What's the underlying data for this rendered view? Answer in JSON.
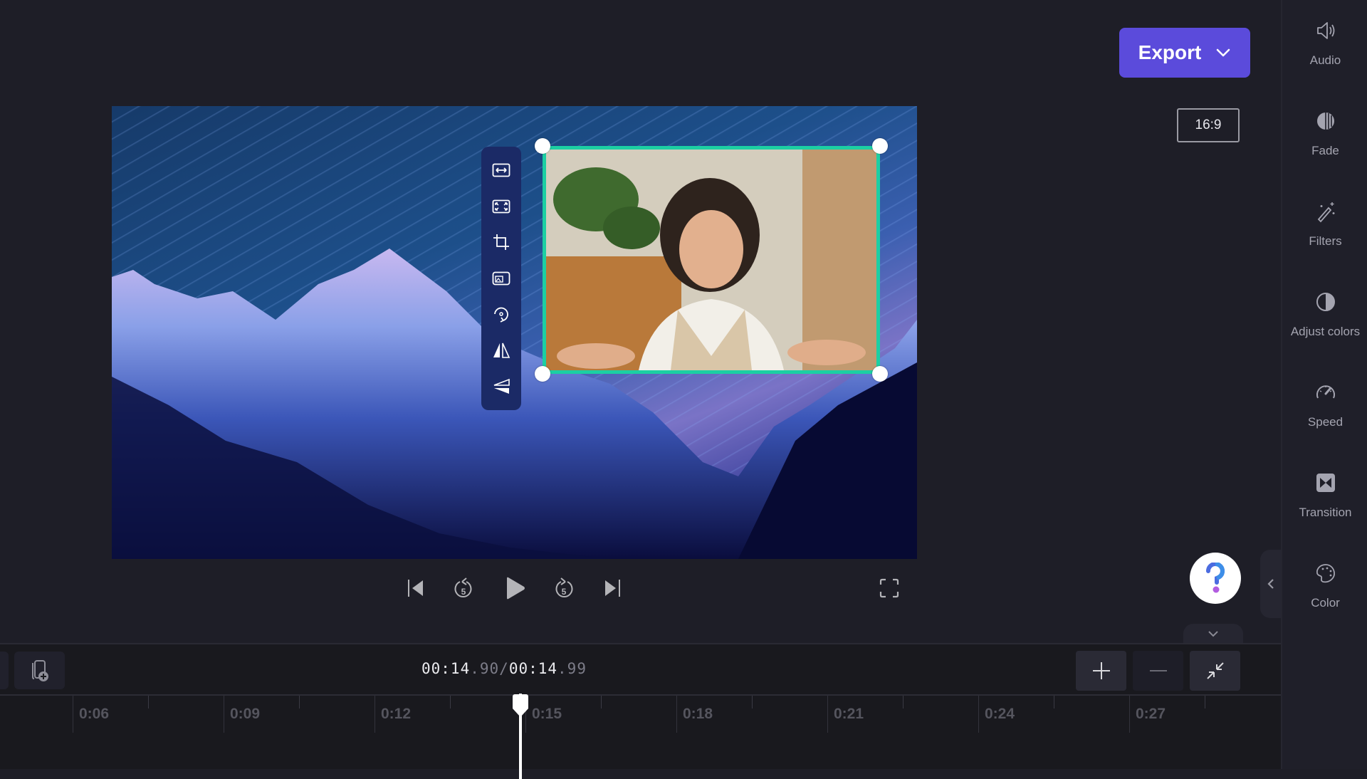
{
  "header": {
    "export_label": "Export",
    "aspect_ratio": "16:9"
  },
  "sidebar": {
    "items": [
      {
        "label": "Audio",
        "icon": "speaker-icon"
      },
      {
        "label": "Fade",
        "icon": "fade-icon"
      },
      {
        "label": "Filters",
        "icon": "magic-wand-icon"
      },
      {
        "label": "Adjust colors",
        "icon": "contrast-icon"
      },
      {
        "label": "Speed",
        "icon": "speedometer-icon"
      },
      {
        "label": "Transition",
        "icon": "transition-icon"
      },
      {
        "label": "Color",
        "icon": "palette-icon"
      }
    ]
  },
  "preview": {
    "floating_toolbar": [
      {
        "name": "fit-button",
        "icon": "fit-width-icon"
      },
      {
        "name": "fill-button",
        "icon": "fill-frame-icon"
      },
      {
        "name": "crop-button",
        "icon": "crop-icon"
      },
      {
        "name": "picture-in-picture-button",
        "icon": "pip-icon"
      },
      {
        "name": "rotate-button",
        "icon": "rotate-icon"
      },
      {
        "name": "flip-horizontal-button",
        "icon": "flip-horizontal-icon"
      },
      {
        "name": "flip-vertical-button",
        "icon": "flip-vertical-icon"
      }
    ],
    "overlay_border_color": "#1ccfa3"
  },
  "playback": {
    "skip_back": "skip-to-start-icon",
    "rewind_label": "5",
    "play": "play-icon",
    "forward_label": "5",
    "skip_forward": "skip-to-end-icon",
    "fullscreen": "fullscreen-icon"
  },
  "timeline": {
    "current_time_main": "00:14",
    "current_time_frac": ".90",
    "separator": "/",
    "total_time_main": "00:14",
    "total_time_frac": ".99",
    "ruler_labels": [
      "0:06",
      "0:09",
      "0:12",
      "0:15",
      "0:18",
      "0:21",
      "0:24",
      "0:27"
    ],
    "playhead_seconds": 14.9
  },
  "colors": {
    "accent": "#5b4bdb",
    "background": "#1e1e27",
    "timeline_bg": "#19191e"
  }
}
